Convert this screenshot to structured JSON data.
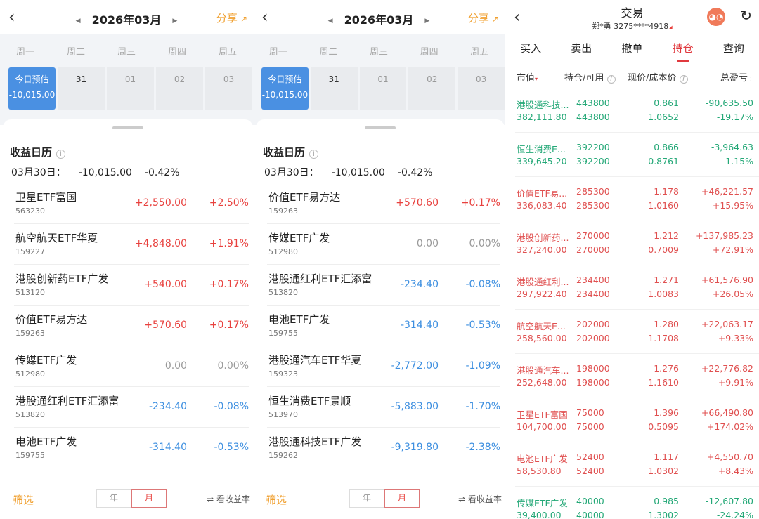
{
  "calendar_panels": [
    {
      "header": {
        "month": "2026年03月",
        "share": "分享"
      },
      "weekdays": [
        "周一",
        "周二",
        "周三",
        "周四",
        "周五"
      ],
      "today_label": "今日预估",
      "today_value": "-10,015.00",
      "days": [
        "31",
        "01",
        "02",
        "03"
      ],
      "title": "收益日历",
      "summary": {
        "date": "03月30日：",
        "value": "-10,015.00",
        "pct": "-0.42%"
      },
      "rows": [
        {
          "name": "卫星ETF富国",
          "code": "563230",
          "value": "+2,550.00",
          "pct": "+2.50%",
          "sign": "pos"
        },
        {
          "name": "航空航天ETF华夏",
          "code": "159227",
          "value": "+4,848.00",
          "pct": "+1.91%",
          "sign": "pos"
        },
        {
          "name": "港股创新药ETF广发",
          "code": "513120",
          "value": "+540.00",
          "pct": "+0.17%",
          "sign": "pos"
        },
        {
          "name": "价值ETF易方达",
          "code": "159263",
          "value": "+570.60",
          "pct": "+0.17%",
          "sign": "pos"
        },
        {
          "name": "传媒ETF广发",
          "code": "512980",
          "value": "0.00",
          "pct": "0.00%",
          "sign": "zero"
        },
        {
          "name": "港股通红利ETF汇添富",
          "code": "513820",
          "value": "-234.40",
          "pct": "-0.08%",
          "sign": "neg"
        },
        {
          "name": "电池ETF广发",
          "code": "159755",
          "value": "-314.40",
          "pct": "-0.53%",
          "sign": "neg"
        }
      ],
      "footer": {
        "filter": "筛选",
        "year": "年",
        "month": "月",
        "toggle": "看收益率"
      }
    },
    {
      "header": {
        "month": "2026年03月",
        "share": "分享"
      },
      "weekdays": [
        "周一",
        "周二",
        "周三",
        "周四",
        "周五"
      ],
      "today_label": "今日预估",
      "today_value": "-10,015.00",
      "days": [
        "31",
        "01",
        "02",
        "03"
      ],
      "title": "收益日历",
      "summary": {
        "date": "03月30日：",
        "value": "-10,015.00",
        "pct": "-0.42%"
      },
      "rows": [
        {
          "name": "价值ETF易方达",
          "code": "159263",
          "value": "+570.60",
          "pct": "+0.17%",
          "sign": "pos"
        },
        {
          "name": "传媒ETF广发",
          "code": "512980",
          "value": "0.00",
          "pct": "0.00%",
          "sign": "zero"
        },
        {
          "name": "港股通红利ETF汇添富",
          "code": "513820",
          "value": "-234.40",
          "pct": "-0.08%",
          "sign": "neg"
        },
        {
          "name": "电池ETF广发",
          "code": "159755",
          "value": "-314.40",
          "pct": "-0.53%",
          "sign": "neg"
        },
        {
          "name": "港股通汽车ETF华夏",
          "code": "159323",
          "value": "-2,772.00",
          "pct": "-1.09%",
          "sign": "neg"
        },
        {
          "name": "恒生消费ETF景顺",
          "code": "513970",
          "value": "-5,883.00",
          "pct": "-1.70%",
          "sign": "neg"
        },
        {
          "name": "港股通科技ETF广发",
          "code": "159262",
          "value": "-9,319.80",
          "pct": "-2.38%",
          "sign": "neg"
        }
      ],
      "footer": {
        "filter": "筛选",
        "year": "年",
        "month": "月",
        "toggle": "看收益率"
      }
    }
  ],
  "trade": {
    "title": "交易",
    "account": "郑*勇 3275****4918",
    "tabs": [
      "买入",
      "卖出",
      "撤单",
      "持仓",
      "查询"
    ],
    "active_tab": "持仓",
    "columns": [
      "市值",
      "持仓/可用",
      "现价/成本价",
      "总盈亏"
    ],
    "holdings": [
      {
        "name": "港股通科技...",
        "mv": "382,111.80",
        "hold": "443800",
        "avail": "443800",
        "price": "0.861",
        "cost": "1.0652",
        "pl": "-90,635.50",
        "plpct": "-19.17%",
        "dir": "dn"
      },
      {
        "name": "恒生消费E...",
        "mv": "339,645.20",
        "hold": "392200",
        "avail": "392200",
        "price": "0.866",
        "cost": "0.8761",
        "pl": "-3,964.63",
        "plpct": "-1.15%",
        "dir": "dn"
      },
      {
        "name": "价值ETF易...",
        "mv": "336,083.40",
        "hold": "285300",
        "avail": "285300",
        "price": "1.178",
        "cost": "1.0160",
        "pl": "+46,221.57",
        "plpct": "+15.95%",
        "dir": "up"
      },
      {
        "name": "港股创新药...",
        "mv": "327,240.00",
        "hold": "270000",
        "avail": "270000",
        "price": "1.212",
        "cost": "0.7009",
        "pl": "+137,985.23",
        "plpct": "+72.91%",
        "dir": "up"
      },
      {
        "name": "港股通红利...",
        "mv": "297,922.40",
        "hold": "234400",
        "avail": "234400",
        "price": "1.271",
        "cost": "1.0083",
        "pl": "+61,576.90",
        "plpct": "+26.05%",
        "dir": "up"
      },
      {
        "name": "航空航天E...",
        "mv": "258,560.00",
        "hold": "202000",
        "avail": "202000",
        "price": "1.280",
        "cost": "1.1708",
        "pl": "+22,063.17",
        "plpct": "+9.33%",
        "dir": "up"
      },
      {
        "name": "港股通汽车...",
        "mv": "252,648.00",
        "hold": "198000",
        "avail": "198000",
        "price": "1.276",
        "cost": "1.1610",
        "pl": "+22,776.82",
        "plpct": "+9.91%",
        "dir": "up"
      },
      {
        "name": "卫星ETF富国",
        "mv": "104,700.00",
        "hold": "75000",
        "avail": "75000",
        "price": "1.396",
        "cost": "0.5095",
        "pl": "+66,490.80",
        "plpct": "+174.02%",
        "dir": "up"
      },
      {
        "name": "电池ETF广发",
        "mv": "58,530.80",
        "hold": "52400",
        "avail": "52400",
        "price": "1.117",
        "cost": "1.0302",
        "pl": "+4,550.70",
        "plpct": "+8.43%",
        "dir": "up"
      },
      {
        "name": "传媒ETF广发",
        "mv": "39,400.00",
        "hold": "40000",
        "avail": "40000",
        "price": "0.985",
        "cost": "1.3002",
        "pl": "-12,607.80",
        "plpct": "-24.24%",
        "dir": "dn"
      }
    ]
  }
}
